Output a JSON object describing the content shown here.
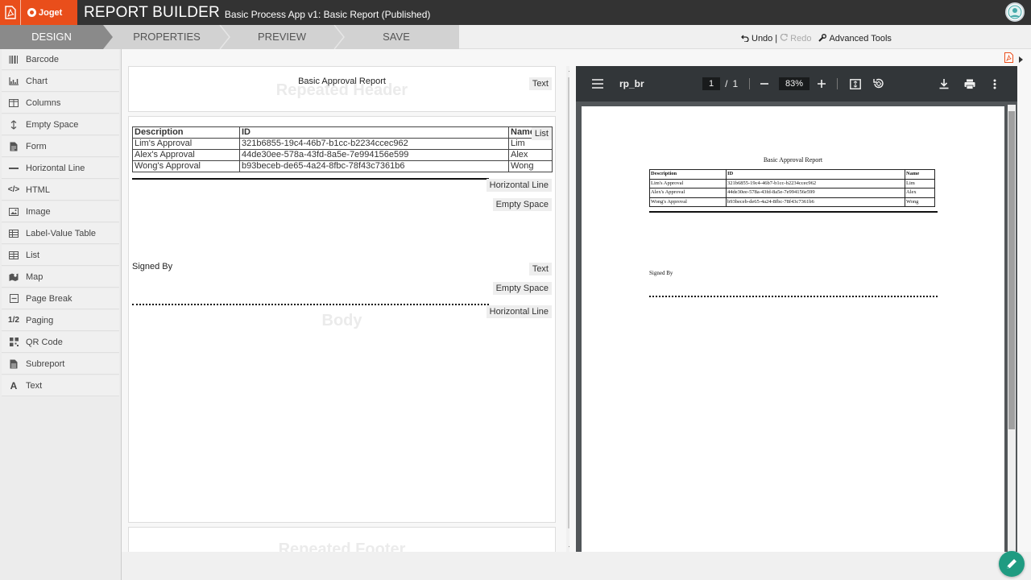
{
  "topbar": {
    "logo_text": "Joget",
    "title": "REPORT BUILDER",
    "subtitle": "Basic Process App v1: Basic Report (Published)"
  },
  "steps": [
    {
      "label": "DESIGN",
      "active": true
    },
    {
      "label": "PROPERTIES",
      "active": false
    },
    {
      "label": "PREVIEW",
      "active": false
    },
    {
      "label": "SAVE",
      "active": false
    }
  ],
  "toolbar": {
    "undo_label": "Undo",
    "separator": "|",
    "redo_label": "Redo",
    "advanced_label": "Advanced Tools"
  },
  "palette": [
    {
      "label": "Barcode",
      "icon": "barcode-icon"
    },
    {
      "label": "Chart",
      "icon": "chart-icon"
    },
    {
      "label": "Columns",
      "icon": "columns-icon"
    },
    {
      "label": "Empty Space",
      "icon": "vertical-arrows-icon"
    },
    {
      "label": "Form",
      "icon": "form-icon"
    },
    {
      "label": "Horizontal Line",
      "icon": "minus-icon"
    },
    {
      "label": "HTML",
      "icon": "code-icon"
    },
    {
      "label": "Image",
      "icon": "image-icon"
    },
    {
      "label": "Label-Value Table",
      "icon": "table-icon"
    },
    {
      "label": "List",
      "icon": "list-table-icon"
    },
    {
      "label": "Map",
      "icon": "map-icon"
    },
    {
      "label": "Page Break",
      "icon": "page-break-icon"
    },
    {
      "label": "Paging",
      "icon": "paging-icon"
    },
    {
      "label": "QR Code",
      "icon": "qr-icon"
    },
    {
      "label": "Subreport",
      "icon": "subreport-icon"
    },
    {
      "label": "Text",
      "icon": "text-icon"
    }
  ],
  "palette_glyphs": {
    "paging": "1/2",
    "text": "A",
    "html": "</>"
  },
  "design": {
    "header_watermark": "Repeated Header",
    "header_text": "Basic Approval Report",
    "body_watermark": "Body",
    "footer_watermark": "Repeated Footer",
    "signed_by": "Signed By",
    "tags": {
      "text": "Text",
      "list": "List",
      "horizontal_line": "Horizontal Line",
      "empty_space": "Empty Space"
    },
    "table": {
      "headers": [
        "Description",
        "ID",
        "Name"
      ],
      "rows": [
        [
          "Lim's Approval",
          "321b6855-19c4-46b7-b1cc-b2234ccec962",
          "Lim"
        ],
        [
          "Alex's Approval",
          "44de30ee-578a-43fd-8a5e-7e994156e599",
          "Alex"
        ],
        [
          "Wong's Approval",
          "b93beceb-de65-4a24-8fbc-78f43c7361b6",
          "Wong"
        ]
      ]
    }
  },
  "viewer": {
    "doc_name": "rp_br",
    "page_current": "1",
    "page_sep": "/",
    "page_total": "1",
    "zoom": "83%",
    "title": "Basic Approval Report",
    "signed_by": "Signed By"
  },
  "colors": {
    "brand": "#e94e1b",
    "topbar": "#333333",
    "fab": "#1f9b81"
  }
}
